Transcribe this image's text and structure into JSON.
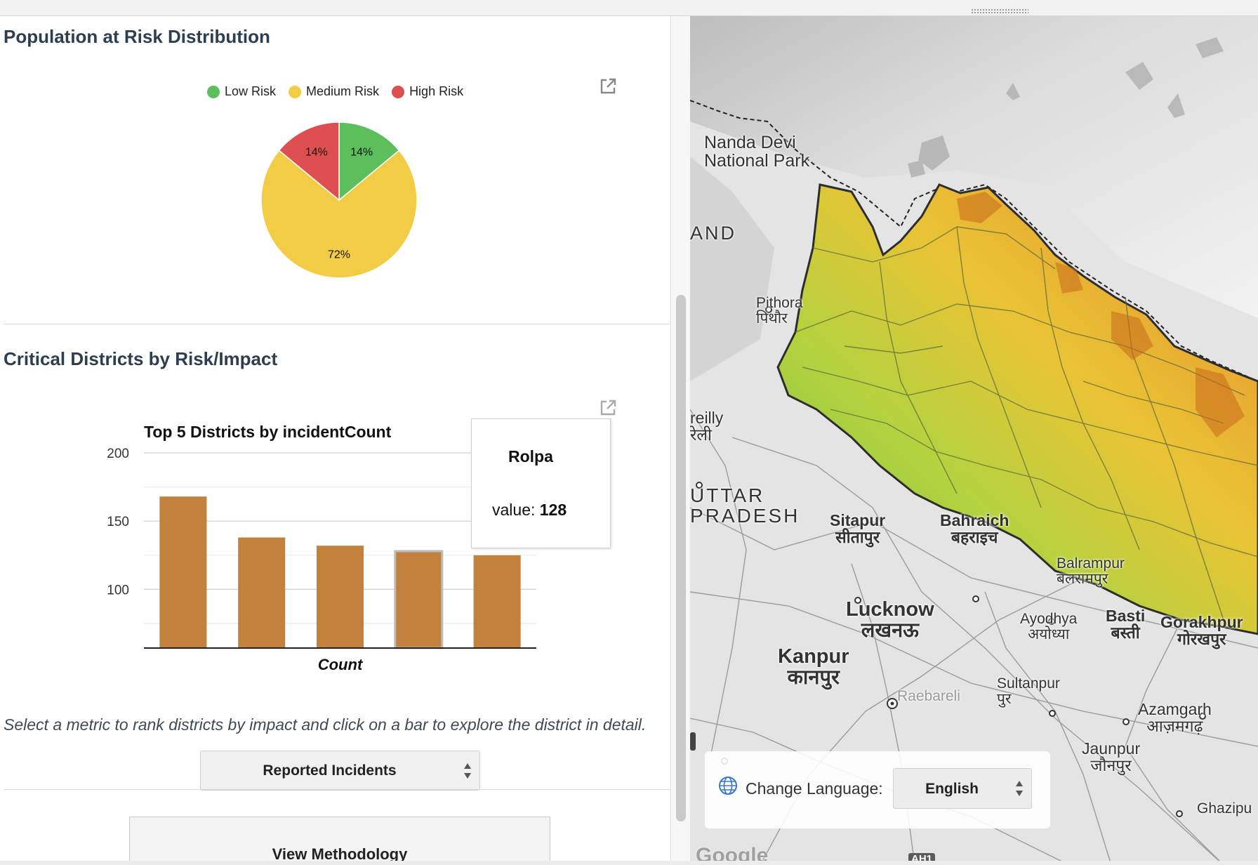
{
  "pie_section": {
    "title": "Population at Risk Distribution",
    "legend": [
      {
        "label": "Low Risk",
        "color": "#5cbf5c"
      },
      {
        "label": "Medium Risk",
        "color": "#f2cc44"
      },
      {
        "label": "High Risk",
        "color": "#de4f4f"
      }
    ]
  },
  "bar_section": {
    "title": "Critical Districts by Risk/Impact",
    "caption": "Select a metric to rank districts by impact and click on a bar to explore the district in detail.",
    "metric_select": "Reported Incidents",
    "methodology_button": "View Methodology"
  },
  "tooltip": {
    "title": "Rolpa",
    "label": "value: ",
    "value": "128"
  },
  "chart_data": [
    {
      "type": "pie",
      "labels": [
        "Low Risk",
        "Medium Risk",
        "High Risk"
      ],
      "values": [
        14,
        72,
        14
      ],
      "display_labels": [
        "14%",
        "72%",
        "14%"
      ],
      "colors": [
        "#5cbf5c",
        "#f2cc44",
        "#de4f4f"
      ],
      "legend": "top"
    },
    {
      "type": "bar",
      "title": "Top 5 Districts by incidentCount",
      "xlabel": "Count",
      "ylabel": "",
      "values": [
        168,
        138,
        132,
        128,
        125
      ],
      "highlighted_index": 3,
      "yticks": [
        100,
        150,
        200
      ],
      "ylim": [
        57,
        200
      ],
      "grid": true,
      "color": "#c2823e"
    }
  ],
  "map": {
    "labels": [
      {
        "text": "Nanda Devi\nNational Park",
        "size": 25,
        "bold": false
      },
      {
        "text": "AND",
        "size": 27,
        "bold": false,
        "spaced": true
      },
      {
        "text": "Pithora\nपिथौर",
        "size": 21,
        "bold": false
      },
      {
        "text": "reilly\nरेली",
        "size": 23,
        "bold": false
      },
      {
        "text": "UTTAR\nPRADESH",
        "size": 28,
        "bold": false,
        "spaced": true
      },
      {
        "text": "Sitapur\nसीतापुर",
        "size": 23,
        "bold": true
      },
      {
        "text": "Bahraich\nबहराइच",
        "size": 23,
        "bold": true
      },
      {
        "text": "Balrampur\nबलरामपुर",
        "size": 21,
        "bold": false
      },
      {
        "text": "Lucknow\nलखनऊ",
        "size": 29,
        "bold": true
      },
      {
        "text": "Ayodhya\nअयोध्या",
        "size": 21,
        "bold": false
      },
      {
        "text": "Basti\nबस्ती",
        "size": 23,
        "bold": true
      },
      {
        "text": "Gorakhpur\nगोरखपुर",
        "size": 23,
        "bold": true
      },
      {
        "text": "Kanpur\nकानपुर",
        "size": 29,
        "bold": true
      },
      {
        "text": "Raebareli",
        "size": 21,
        "bold": false
      },
      {
        "text": "Sultanpur\nपुर",
        "size": 21,
        "bold": false
      },
      {
        "text": "Azamgarh\nआज़मगढ़",
        "size": 23,
        "bold": false
      },
      {
        "text": "Jaunpur\nजौनपुर",
        "size": 23,
        "bold": false
      },
      {
        "text": "Ghazipu",
        "size": 21,
        "bold": false
      },
      {
        "text": "AH1",
        "size": 15,
        "bold": true
      },
      {
        "text": "Google",
        "size": 30,
        "bold": true
      }
    ],
    "language_label": "Change Language:",
    "language_value": "English"
  }
}
